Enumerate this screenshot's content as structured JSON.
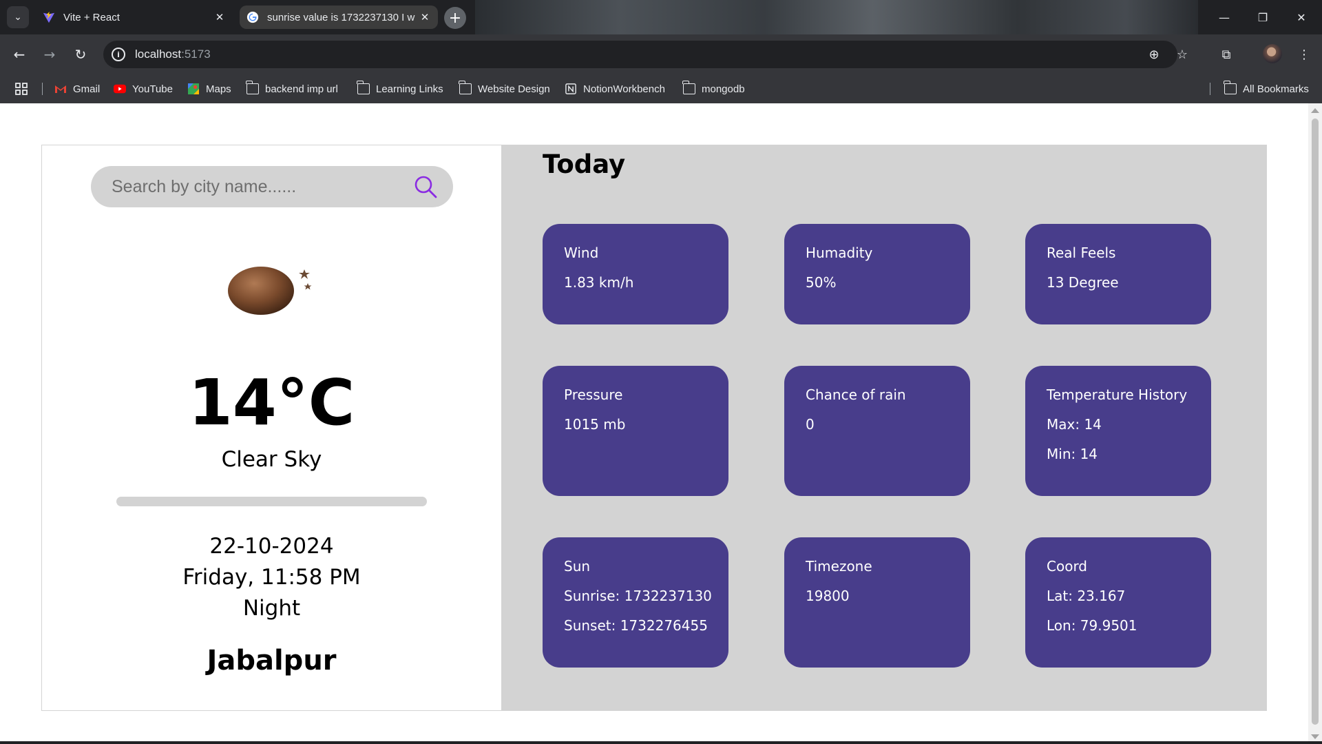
{
  "browser": {
    "tabs": [
      {
        "title": "Vite + React",
        "active": false
      },
      {
        "title": "sunrise value is 1732237130 I w",
        "active": true
      }
    ],
    "url_host": "localhost",
    "url_port": ":5173",
    "bookmarks": [
      "Gmail",
      "YouTube",
      "Maps",
      "backend imp url",
      "Learning Links",
      "Website Design",
      "NotionWorkbench",
      "mongodb"
    ],
    "all_bookmarks": "All Bookmarks"
  },
  "search": {
    "placeholder": "Search by city name......"
  },
  "current": {
    "icon": "weather-night-icon",
    "temperature": "14°C",
    "description": "Clear Sky",
    "date": "22-10-2024",
    "day_time": "Friday, 11:58 PM",
    "period": "Night",
    "city": "Jabalpur"
  },
  "today": {
    "heading": "Today",
    "cards": [
      {
        "title": "Wind",
        "lines": [
          "1.83 km/h"
        ]
      },
      {
        "title": "Humadity",
        "lines": [
          "50%"
        ]
      },
      {
        "title": "Real Feels",
        "lines": [
          "13 Degree"
        ]
      },
      {
        "title": "Pressure",
        "lines": [
          "1015 mb"
        ]
      },
      {
        "title": "Chance of rain",
        "lines": [
          "0"
        ]
      },
      {
        "title": "Temperature History",
        "lines": [
          "Max: 14",
          "Min: 14"
        ]
      },
      {
        "title": "Sun",
        "lines": [
          "Sunrise: 1732237130",
          "Sunset: 1732276455"
        ]
      },
      {
        "title": "Timezone",
        "lines": [
          "19800"
        ]
      },
      {
        "title": "Coord",
        "lines": [
          "Lat: 23.167",
          "Lon: 79.9501"
        ]
      }
    ]
  },
  "colors": {
    "card": "#483d8b",
    "panel": "#d3d3d3",
    "search_icon": "#8a2be2"
  }
}
